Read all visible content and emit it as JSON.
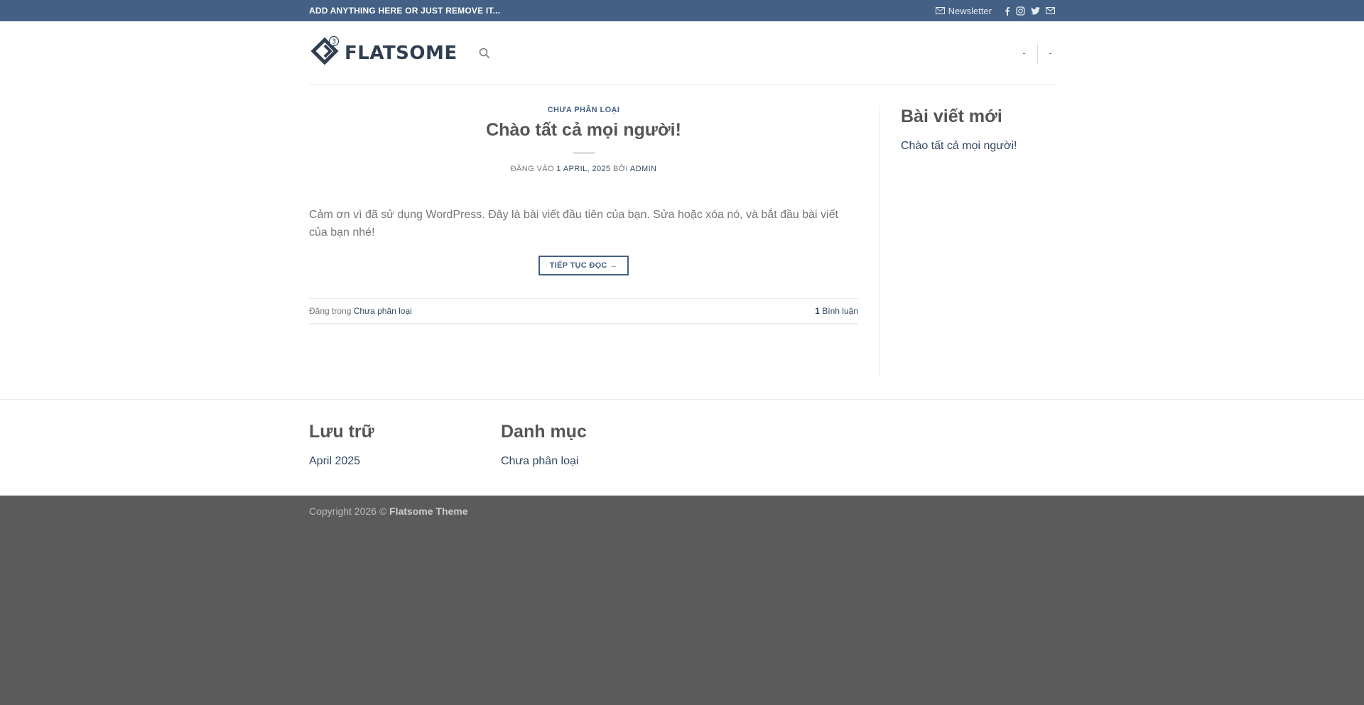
{
  "topbar": {
    "promo": "ADD ANYTHING HERE OR JUST REMOVE IT...",
    "newsletter": "Newsletter",
    "social_icons": [
      "facebook-icon",
      "instagram-icon",
      "twitter-icon",
      "email-icon"
    ],
    "bg_color": "#446084"
  },
  "header": {
    "logo_text": "FLATSOME",
    "logo_badge": "3",
    "right_items": [
      "-",
      "-"
    ]
  },
  "post": {
    "category": "CHƯA PHÂN LOẠI",
    "title": "Chào tất cả mọi người!",
    "meta_prefix": "ĐĂNG VÀO",
    "date": "1 APRIL, 2025",
    "meta_by": "BỞI",
    "author": "ADMIN",
    "excerpt": "Cảm ơn vì đã sử dụng WordPress. Đây là bài viết đầu tiên của bạn. Sửa hoặc xóa nó, và bắt đầu bài viết của bạn nhé!",
    "read_more": "TIẾP TỤC ĐỌC →",
    "posted_in_label": "Đăng trong",
    "posted_in_category": "Chưa phân loại",
    "comment_count": "1",
    "comment_label": "Bình luận"
  },
  "sidebar": {
    "title": "Bài viết mới",
    "items": [
      "Chào tất cả mọi người!"
    ]
  },
  "widgets": {
    "archive_title": "Lưu trữ",
    "archive_items": [
      "April 2025"
    ],
    "category_title": "Danh mục",
    "category_items": [
      "Chưa phân loại"
    ]
  },
  "footer": {
    "copyright": "Copyright 2026 ©",
    "theme": "Flatsome Theme"
  }
}
